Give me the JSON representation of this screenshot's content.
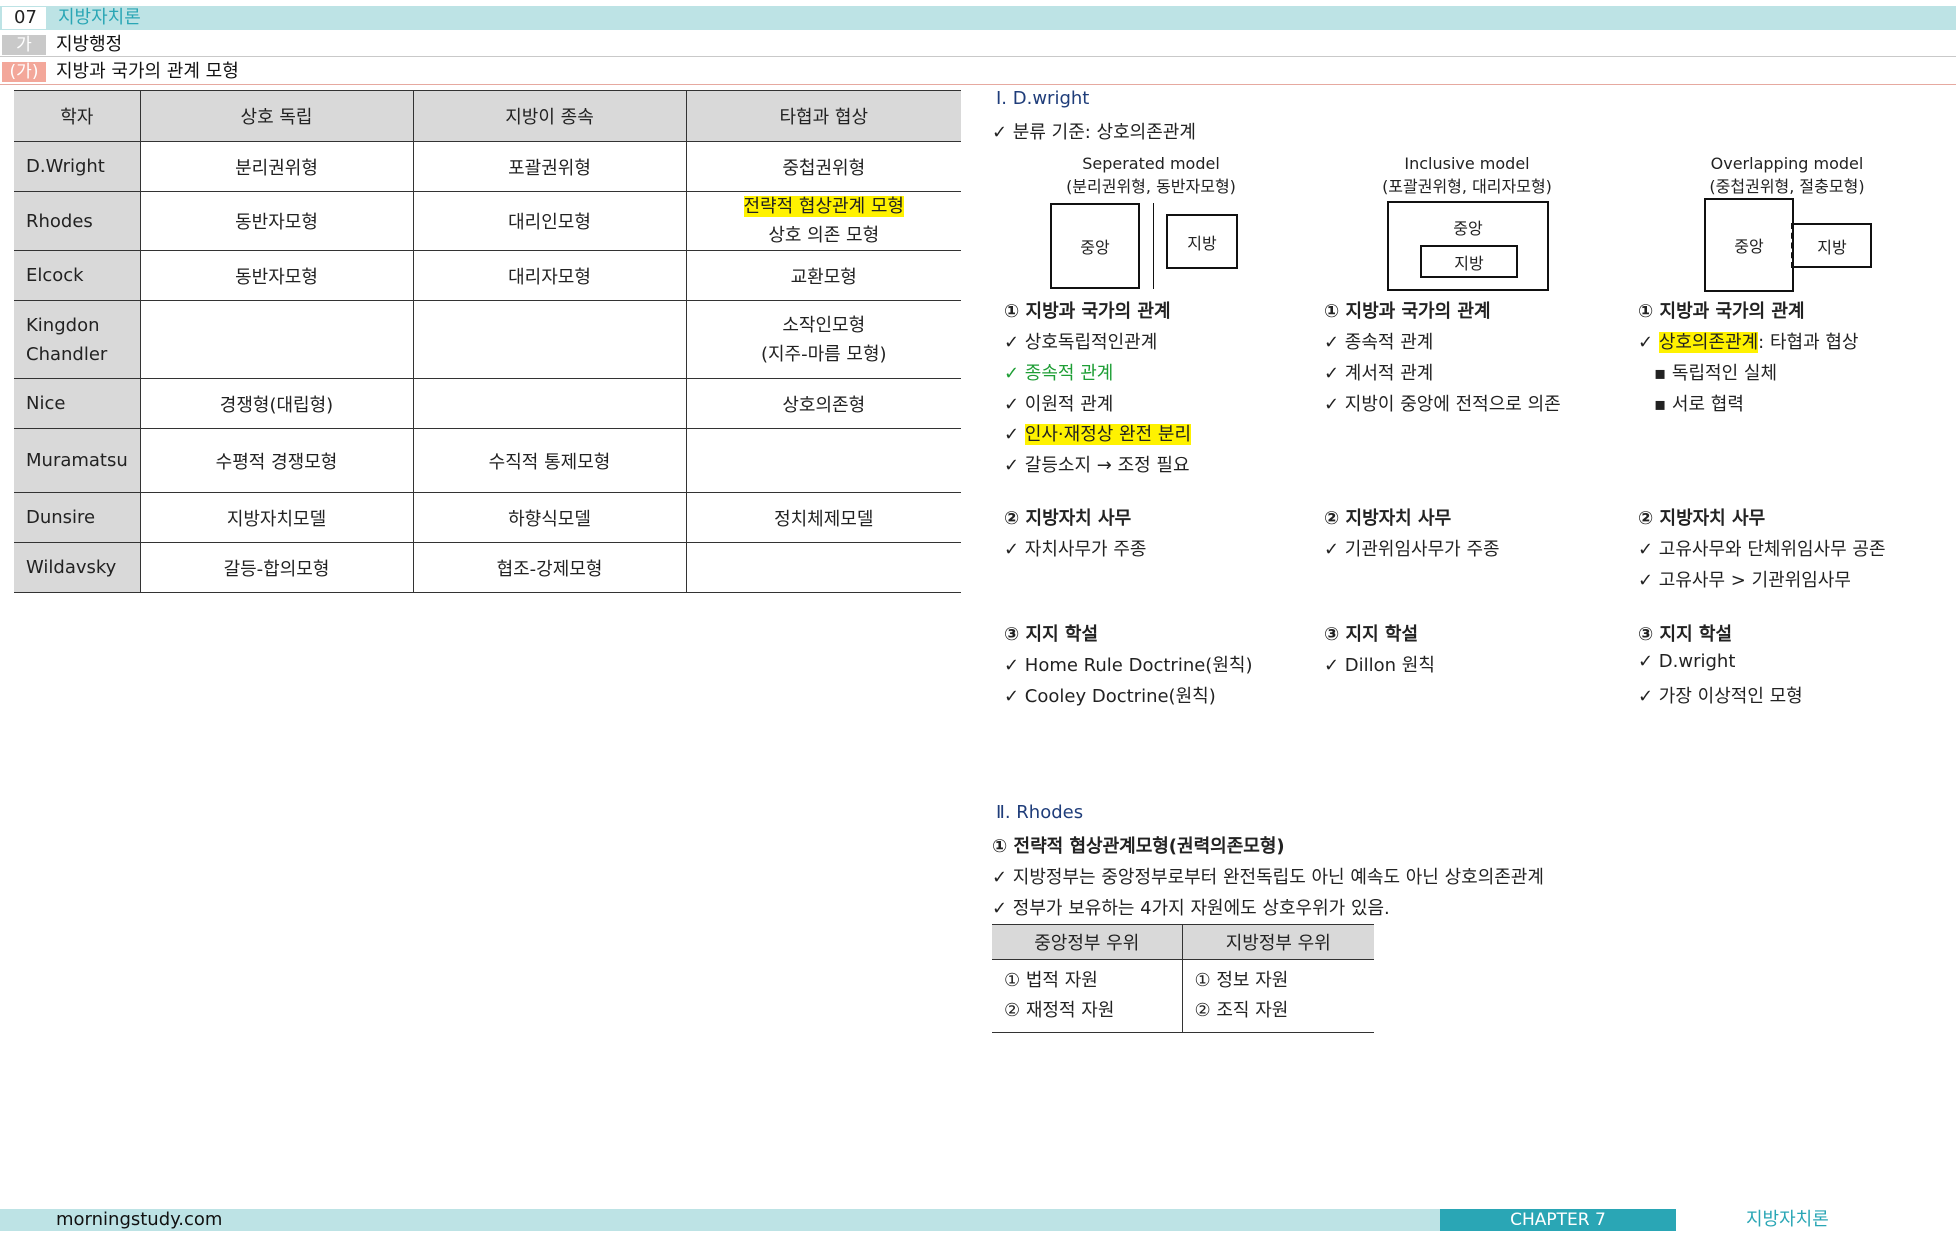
{
  "header": {
    "chapter_num": "07",
    "chapter_title": "지방자치론",
    "sub_tag": "가",
    "sub_title": "지방행정",
    "section_tag": "(가)",
    "section_title": "지방과 국가의 관계 모형"
  },
  "table": {
    "headers": [
      "학자",
      "상호 독립",
      "지방이 종속",
      "타협과 협상"
    ],
    "rows": [
      {
        "name": "D.Wright",
        "c1": "분리권위형",
        "c2": "포괄권위형",
        "c3": "중첩권위형",
        "c3b": ""
      },
      {
        "name": "Rhodes",
        "c1": "동반자모형",
        "c2": "대리인모형",
        "c3": "전략적 협상관계 모형",
        "c3b": "상호 의존 모형"
      },
      {
        "name": "Elcock",
        "c1": "동반자모형",
        "c2": "대리자모형",
        "c3": "교환모형",
        "c3b": ""
      },
      {
        "name": "Kingdon",
        "name2": "Chandler",
        "c1": "",
        "c2": "",
        "c3": "소작인모형",
        "c3b": "(지주-마름 모형)"
      },
      {
        "name": "Nice",
        "c1": "경쟁형(대립형)",
        "c2": "",
        "c3": "상호의존형",
        "c3b": ""
      },
      {
        "name": "Muramatsu",
        "c1": "수평적 경쟁모형",
        "c2": "수직적 통제모형",
        "c3": "",
        "c3b": ""
      },
      {
        "name": "Dunsire",
        "c1": "지방자치모델",
        "c2": "하향식모델",
        "c3": "정치체제모델",
        "c3b": ""
      },
      {
        "name": "Wildavsky",
        "c1": "갈등-합의모형",
        "c2": "협조-강제모형",
        "c3": "",
        "c3b": ""
      }
    ]
  },
  "wright": {
    "heading": "Ⅰ. D.wright",
    "criterion": "✓ 분류 기준: 상호의존관계",
    "models": [
      {
        "title": "Seperated model",
        "sub": "(분리권위형, 동반자모형)",
        "box_a": "중앙",
        "box_b": "지방"
      },
      {
        "title": "Inclusive model",
        "sub": "(포괄권위형, 대리자모형)",
        "box_a": "중앙",
        "box_b": "지방"
      },
      {
        "title": "Overlapping model",
        "sub": "(중첩권위형, 절충모형)",
        "box_a": "중앙",
        "box_b": "지방"
      }
    ],
    "col1": {
      "h1": "① 지방과 국가의 관계",
      "l1": "✓ 상호독립적인관계",
      "l2": "✓ 종속적 관계",
      "l3": "✓ 이원적 관계",
      "l4_check": "✓ ",
      "l4_hl": "인사·재정상 완전 분리",
      "l5": "✓ 갈등소지 → 조정 필요",
      "h2": "② 지방자치 사무",
      "m1": "✓ 자치사무가 주종",
      "h3": "③ 지지 학설",
      "s1": "✓ Home Rule Doctrine(원칙)",
      "s2": "✓ Cooley Doctrine(원칙)"
    },
    "col2": {
      "h1": "① 지방과 국가의 관계",
      "l1": "✓ 종속적 관계",
      "l2": "✓ 계서적 관계",
      "l3": "✓ 지방이 중앙에 전적으로 의존",
      "h2": "② 지방자치 사무",
      "m1": "✓ 기관위임사무가 주종",
      "h3": "③ 지지 학설",
      "s1": "✓ Dillon 원칙"
    },
    "col3": {
      "h1": "① 지방과 국가의 관계",
      "l1_check": "✓ ",
      "l1_hl": "상호의존관계",
      "l1_rest": ": 타협과 협상",
      "l2": "▪ 독립적인 실체",
      "l3": "▪ 서로 협력",
      "h2": "② 지방자치 사무",
      "m1": "✓ 고유사무와 단체위임사무 공존",
      "m2": "✓ 고유사무 > 기관위임사무",
      "h3": "③ 지지 학설",
      "s1": "✓ D.wright",
      "s2": "✓ 가장 이상적인 모형"
    }
  },
  "rhodes": {
    "heading": "Ⅱ. Rhodes",
    "sub": "① 전략적 협상관계모형(권력의존모형)",
    "l1": "✓ 지방정부는 중앙정부로부터 완전독립도 아닌 예속도 아닌 상호의존관계",
    "l2": "✓ 정부가 보유하는 4가지 자원에도 상호우위가 있음.",
    "res_headers": [
      "중앙정부 우위",
      "지방정부 우위"
    ],
    "res_left": [
      "① 법적 자원",
      "② 재정적 자원"
    ],
    "res_right": [
      "① 정보 자원",
      "② 조직 자원"
    ]
  },
  "footer": {
    "site": "morningstudy.com",
    "chapter": "CHAPTER 7",
    "subject": "지방자치론"
  }
}
